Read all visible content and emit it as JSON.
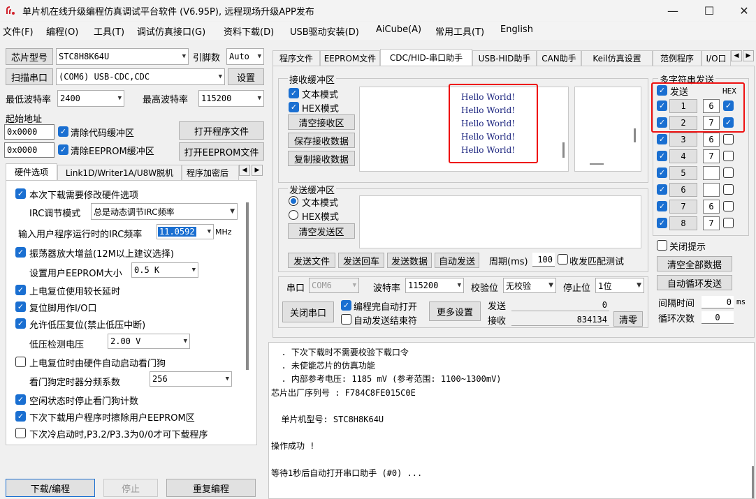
{
  "app": {
    "title": "单片机在线升级编程仿真调试平台软件 (V6.95P), 远程现场升级APP发布",
    "minimize": "—",
    "maximize": "☐",
    "close": "✕"
  },
  "menu": [
    "文件(F)",
    "编程(O)",
    "工具(T)",
    "调试仿真接口(G)",
    "资料下载(D)",
    "USB驱动安装(D)",
    "AiCube(A)",
    "常用工具(T)",
    "English"
  ],
  "left": {
    "chip_btn": "芯片型号",
    "chip_value": "STC8H8K64U",
    "pin_label": "引脚数",
    "pin_value": "Auto",
    "scan_btn": "扫描串口",
    "port_value": "(COM6) USB-CDC,CDC",
    "settings_btn": "设置",
    "min_baud_label": "最低波特率",
    "min_baud": "2400",
    "max_baud_label": "最高波特率",
    "max_baud": "115200",
    "start_addr_label": "起始地址",
    "addr1": "0x0000",
    "clear_code": "清除代码缓冲区",
    "open_prog": "打开程序文件",
    "addr2": "0x0000",
    "clear_eeprom": "清除EEPROM缓冲区",
    "open_eeprom": "打开EEPROM文件",
    "tabs": [
      "硬件选项",
      "Link1D/Writer1A/U8W脱机",
      "程序加密后"
    ],
    "opts": {
      "modify_hw": "本次下载需要修改硬件选项",
      "irc_mode_label": "IRC调节模式",
      "irc_mode": "总是动态调节IRC频率",
      "freq_label": "输入用户程序运行时的IRC频率",
      "freq_value": "11.0592",
      "freq_unit": "MHz",
      "osc_gain": "振荡器放大增益(12M以上建议选择)",
      "eeprom_size_label": "设置用户EEPROM大小",
      "eeprom_size": "0.5 K",
      "long_reset": "上电复位使用较长延时",
      "reset_io": "复位脚用作I/O口",
      "lvr": "允许低压复位(禁止低压中断)",
      "lv_label": "低压检测电压",
      "lv_value": "2.00 V",
      "wdt_auto": "上电复位时由硬件自动启动看门狗",
      "wdt_div_label": "看门狗定时器分频系数",
      "wdt_div": "256",
      "idle_wdt": "空闲状态时停止看门狗计数",
      "erase_eeprom": "下次下载用户程序时擦除用户EEPROM区",
      "p32p33": "下次冷启动时,P3.2/P3.3为0/0才可下载程序"
    },
    "download_btn": "下载/编程",
    "stop_btn": "停止",
    "reprog_btn": "重复编程"
  },
  "right": {
    "tabs": [
      "程序文件",
      "EEPROM文件",
      "CDC/HID-串口助手",
      "USB-HID助手",
      "CAN助手",
      "Keil仿真设置",
      "范例程序",
      "I/O口"
    ],
    "recv": {
      "title": "接收缓冲区",
      "text_mode": "文本模式",
      "hex_mode": "HEX模式",
      "clear": "清空接收区",
      "save": "保存接收数据",
      "copy": "复制接收数据",
      "lines": [
        "Hello World!",
        "Hello World!",
        "Hello World!",
        "Hello World!",
        "Hello World!"
      ]
    },
    "send": {
      "title": "发送缓冲区",
      "text_mode": "文本模式",
      "hex_mode": "HEX模式",
      "clear": "清空发送区",
      "send_file": "发送文件",
      "send_cr": "发送回车",
      "send_data": "发送数据",
      "auto_send": "自动发送",
      "period_label": "周期(ms)",
      "period": "100",
      "match_test": "收发匹配测试"
    },
    "serial": {
      "port_label": "串口",
      "port": "COM6",
      "baud_label": "波特率",
      "baud": "115200",
      "parity_label": "校验位",
      "parity": "无校验",
      "stop_label": "停止位",
      "stop": "1位",
      "close_btn": "关闭串口",
      "auto_open": "编程完自动打开",
      "auto_end": "自动发送结束符",
      "more": "更多设置",
      "tx_label": "发送",
      "tx": "0",
      "rx_label": "接收",
      "rx": "834134",
      "clear_btn": "清零"
    },
    "multi": {
      "title": "多字符串发送",
      "send_label": "发送",
      "hex_label": "HEX",
      "rows": [
        {
          "idx": "1",
          "val": "6",
          "hex": true
        },
        {
          "idx": "2",
          "val": "7",
          "hex": true
        },
        {
          "idx": "3",
          "val": "6",
          "hex": false
        },
        {
          "idx": "4",
          "val": "7",
          "hex": false
        },
        {
          "idx": "5",
          "val": "",
          "hex": false
        },
        {
          "idx": "6",
          "val": "",
          "hex": false
        },
        {
          "idx": "7",
          "val": "6",
          "hex": false
        },
        {
          "idx": "8",
          "val": "7",
          "hex": false
        }
      ],
      "close_hint": "关闭提示",
      "clear_all": "清空全部数据",
      "auto_loop": "自动循环发送",
      "interval_label": "间隔时间",
      "interval": "0",
      "interval_unit": "ms",
      "loop_label": "循环次数",
      "loop": "0"
    },
    "log": [
      "  . 下次下载时不需要校验下载口令",
      "  . 未使能芯片的仿真功能",
      "  . 内部参考电压: 1185 mV (参考范围: 1100~1300mV)",
      "芯片出厂序列号 : F784C8FE015C0E",
      "",
      "  单片机型号: STC8H8K64U",
      "",
      "操作成功 !",
      "",
      "等待1秒后自动打开串口助手 (#0) ..."
    ]
  }
}
